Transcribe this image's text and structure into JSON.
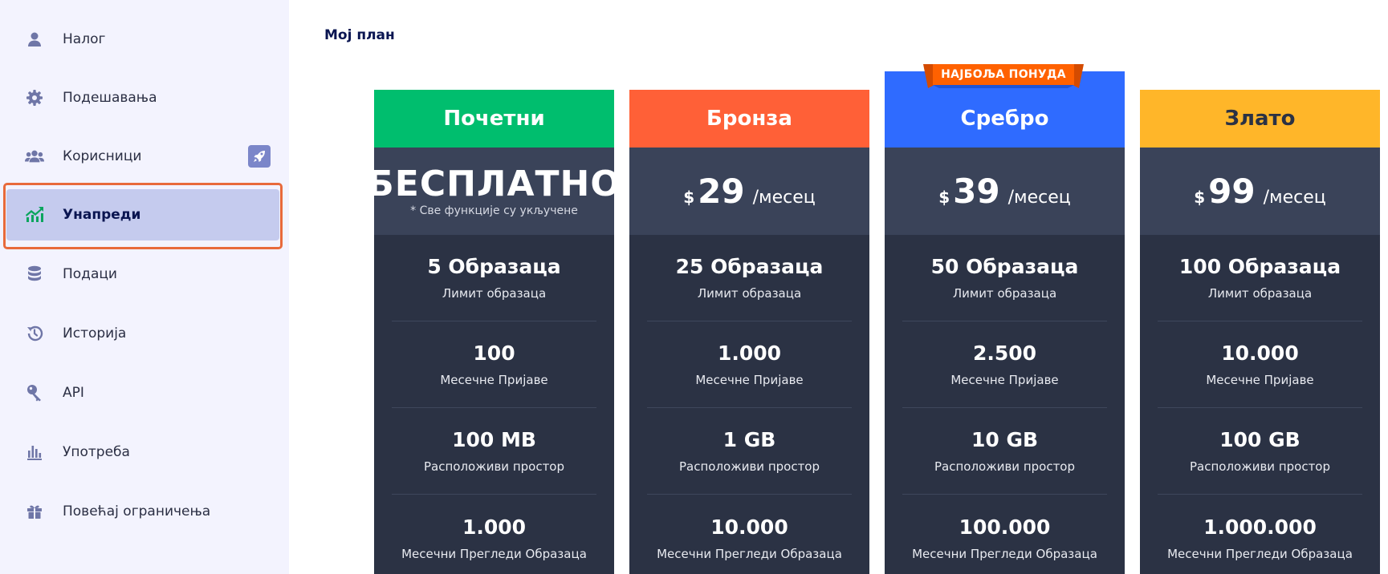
{
  "sidebar": {
    "items": [
      {
        "label": "Налог",
        "icon": "user-icon"
      },
      {
        "label": "Подешавања",
        "icon": "gear-icon"
      },
      {
        "label": "Корисници",
        "icon": "users-icon"
      },
      {
        "label": "Унапреди",
        "icon": "upgrade-chart-icon"
      },
      {
        "label": "Подаци",
        "icon": "database-icon"
      },
      {
        "label": "Историја",
        "icon": "history-icon"
      },
      {
        "label": "API",
        "icon": "key-icon"
      },
      {
        "label": "Употреба",
        "icon": "bar-chart-icon"
      },
      {
        "label": "Повећај ограничења",
        "icon": "gift-icon"
      }
    ],
    "active_index": 3,
    "users_badge_icon": "rocket-icon"
  },
  "main": {
    "title": "Мој план",
    "best_offer_label": "НАЈБОЉА ПОНУДА",
    "plans": [
      {
        "name": "Почетни",
        "color": "#00be6e",
        "free_label": "БЕСПЛАТНО",
        "free_note": "* Све функције су укључене",
        "features": [
          {
            "value": "5 Образаца",
            "caption": "Лимит образаца"
          },
          {
            "value": "100",
            "caption": "Месечне Пријаве"
          },
          {
            "value": "100 MB",
            "caption": "Расположиви простор"
          },
          {
            "value": "1.000",
            "caption": "Месечни Прегледи Образаца"
          }
        ]
      },
      {
        "name": "Бронза",
        "color": "#ff6037",
        "currency": "$",
        "amount": "29",
        "period": "/месец",
        "features": [
          {
            "value": "25 Образаца",
            "caption": "Лимит образаца"
          },
          {
            "value": "1.000",
            "caption": "Месечне Пријаве"
          },
          {
            "value": "1 GB",
            "caption": "Расположиви простор"
          },
          {
            "value": "10.000",
            "caption": "Месечни Прегледи Образаца"
          }
        ]
      },
      {
        "name": "Сребро",
        "color": "#2f6bff",
        "currency": "$",
        "amount": "39",
        "period": "/месец",
        "features": [
          {
            "value": "50 Образаца",
            "caption": "Лимит образаца"
          },
          {
            "value": "2.500",
            "caption": "Месечне Пријаве"
          },
          {
            "value": "10 GB",
            "caption": "Расположиви простор"
          },
          {
            "value": "100.000",
            "caption": "Месечни Прегледи Образаца"
          }
        ]
      },
      {
        "name": "Злато",
        "color": "#ffb629",
        "currency": "$",
        "amount": "99",
        "period": "/месец",
        "features": [
          {
            "value": "100 Образаца",
            "caption": "Лимит образаца"
          },
          {
            "value": "10.000",
            "caption": "Месечне Пријаве"
          },
          {
            "value": "100 GB",
            "caption": "Расположиви простор"
          },
          {
            "value": "1.000.000",
            "caption": "Месечни Прегледи Образаца"
          }
        ]
      }
    ]
  }
}
